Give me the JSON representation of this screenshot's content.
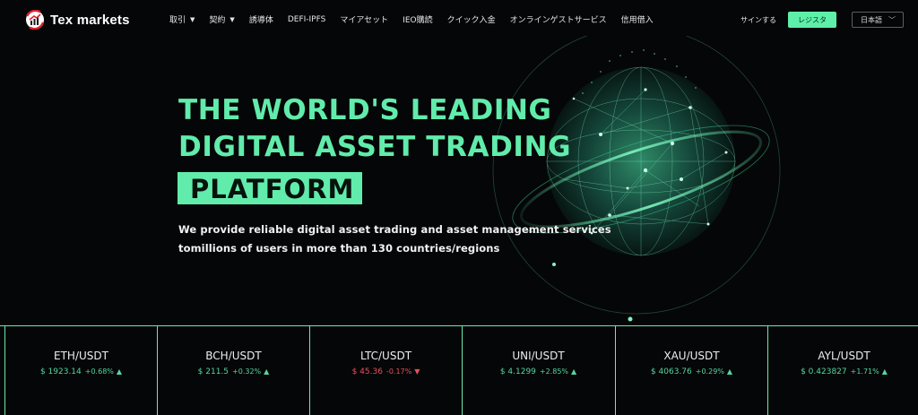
{
  "brand": {
    "name": "Tex markets",
    "logo_icon": "trend-arrow-logo-icon"
  },
  "nav": {
    "items": [
      {
        "label": "取引",
        "dropdown": true
      },
      {
        "label": "契約",
        "dropdown": true
      },
      {
        "label": "誘導体",
        "dropdown": false
      },
      {
        "label": "DEFI-IPFS",
        "dropdown": false
      },
      {
        "label": "マイアセット",
        "dropdown": false
      },
      {
        "label": "IEO購読",
        "dropdown": false
      },
      {
        "label": "クイック入金",
        "dropdown": false
      },
      {
        "label": "オンラインゲストサービス",
        "dropdown": false
      },
      {
        "label": "信用借入",
        "dropdown": false
      }
    ],
    "caret_glyph": "▼",
    "signin_label": "サインする",
    "register_label": "レジスタ",
    "language": "日本語",
    "language_chevron": "﹀"
  },
  "hero": {
    "line1": "THE WORLD'S LEADING",
    "line2": "DIGITAL ASSET TRADING",
    "line3": "PLATFORM",
    "sub1": "We provide reliable digital asset trading and asset management services",
    "sub2": "tomillions  of  users in more than 130 countries/regions"
  },
  "colors": {
    "accent": "#61ecab",
    "up": "#55d6a0",
    "down": "#e9505c",
    "background": "#050607"
  },
  "ticker": [
    {
      "pair": "ETH/USDT",
      "price": "$ 1923.14",
      "change": "+0.68%",
      "dir": "up",
      "arrow": "▲"
    },
    {
      "pair": "BCH/USDT",
      "price": "$ 211.5",
      "change": "+0.32%",
      "dir": "up",
      "arrow": "▲"
    },
    {
      "pair": "LTC/USDT",
      "price": "$ 45.36",
      "change": "-0.17%",
      "dir": "down",
      "arrow": "▼"
    },
    {
      "pair": "UNI/USDT",
      "price": "$ 4.1299",
      "change": "+2.85%",
      "dir": "up",
      "arrow": "▲"
    },
    {
      "pair": "XAU/USDT",
      "price": "$ 4063.76",
      "change": "+0.29%",
      "dir": "up",
      "arrow": "▲"
    },
    {
      "pair": "AYL/USDT",
      "price": "$ 0.423827",
      "change": "+1.71%",
      "dir": "up",
      "arrow": "▲"
    }
  ]
}
